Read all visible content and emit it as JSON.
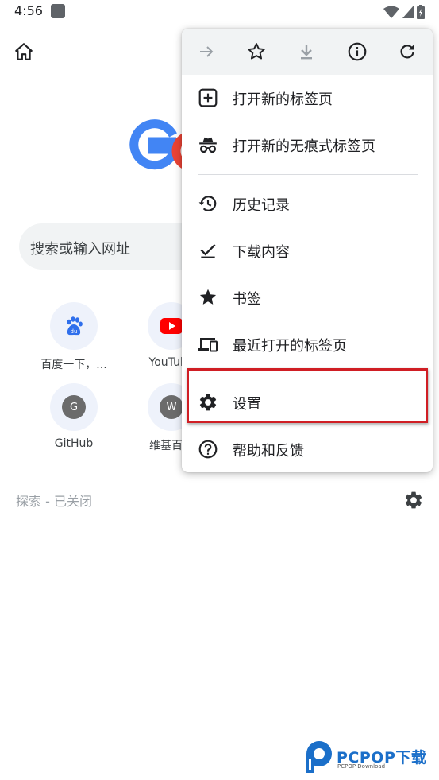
{
  "status_bar": {
    "time": "4:56",
    "icons": [
      "notification-icon",
      "wifi-icon",
      "signal-icon",
      "battery-icon"
    ]
  },
  "toolbar": {
    "home_icon": "home-icon"
  },
  "logo": {
    "text": "Google"
  },
  "search": {
    "placeholder": "搜索或输入网址"
  },
  "shortcuts": [
    {
      "label": "百度一下，...",
      "icon": "baidu-icon"
    },
    {
      "label": "YouTube",
      "icon": "youtube-icon"
    },
    {
      "label": "GitHub",
      "icon": "letter-badge",
      "letter": "G"
    },
    {
      "label": "维基百科",
      "icon": "letter-badge",
      "letter": "W"
    }
  ],
  "discover": {
    "status_text": "探索 - 已关闭",
    "icon": "settings-icon"
  },
  "menu": {
    "toolbar_icons": [
      "forward-icon",
      "bookmark-star-icon",
      "download-icon",
      "info-icon",
      "refresh-icon"
    ],
    "items": [
      {
        "label": "打开新的标签页",
        "icon": "new-tab-icon"
      },
      {
        "label": "打开新的无痕式标签页",
        "icon": "incognito-icon"
      },
      {
        "label": "历史记录",
        "icon": "history-icon"
      },
      {
        "label": "下载内容",
        "icon": "downloads-icon"
      },
      {
        "label": "书签",
        "icon": "bookmarks-icon"
      },
      {
        "label": "最近打开的标签页",
        "icon": "recent-tabs-icon"
      },
      {
        "label": "设置",
        "icon": "settings-icon"
      },
      {
        "label": "帮助和反馈",
        "icon": "help-icon"
      }
    ]
  },
  "annotation": {
    "highlight_color": "#d01e24",
    "highlighted_item": "设置"
  },
  "watermark": {
    "brand": "PCPOP下载",
    "subtitle": "PCPOP Download"
  },
  "colors": {
    "google_blue": "#4285f4",
    "google_red": "#ea4335",
    "icon_gray": "#202124",
    "menu_toolbar_bg": "#f1f3f4",
    "brand_blue": "#1b6fc9"
  }
}
